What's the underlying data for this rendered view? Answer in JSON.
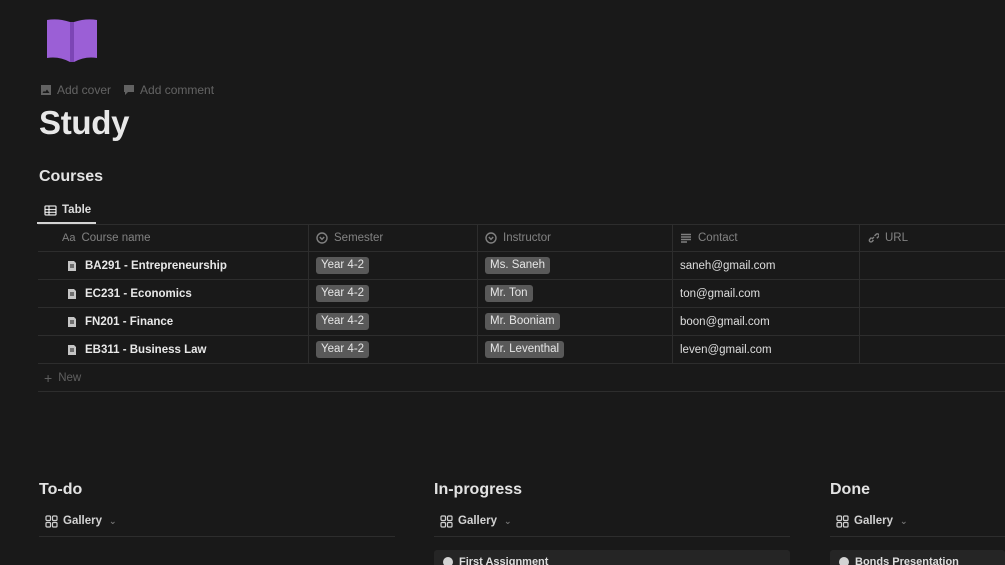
{
  "page": {
    "icon": "book-icon",
    "add_cover": "Add cover",
    "add_comment": "Add comment",
    "title": "Study"
  },
  "courses": {
    "title": "Courses",
    "view_tab": "Table",
    "columns": {
      "name": "Course name",
      "name_prefix": "Aa",
      "semester": "Semester",
      "instructor": "Instructor",
      "contact": "Contact",
      "url": "URL"
    },
    "rows": [
      {
        "name": "BA291 - Entrepreneurship",
        "semester": "Year 4-2",
        "instructor": "Ms. Saneh",
        "contact": "saneh@gmail.com",
        "url": ""
      },
      {
        "name": "EC231 - Economics",
        "semester": "Year 4-2",
        "instructor": "Mr. Ton",
        "contact": "ton@gmail.com",
        "url": ""
      },
      {
        "name": "FN201 - Finance",
        "semester": "Year 4-2",
        "instructor": "Mr. Booniam",
        "contact": "boon@gmail.com",
        "url": ""
      },
      {
        "name": "EB311 - Business Law",
        "semester": "Year 4-2",
        "instructor": "Mr. Leventhal",
        "contact": "leven@gmail.com",
        "url": ""
      }
    ],
    "new_label": "New"
  },
  "boards": [
    {
      "title": "To-do",
      "view": "Gallery",
      "card": ""
    },
    {
      "title": "In-progress",
      "view": "Gallery",
      "card": "First Assignment"
    },
    {
      "title": "Done",
      "view": "Gallery",
      "card": "Bonds Presentation"
    }
  ],
  "colors": {
    "background": "#191919",
    "icon_purple": "#9b5fd6",
    "tag_gray": "#5a5a5a"
  }
}
